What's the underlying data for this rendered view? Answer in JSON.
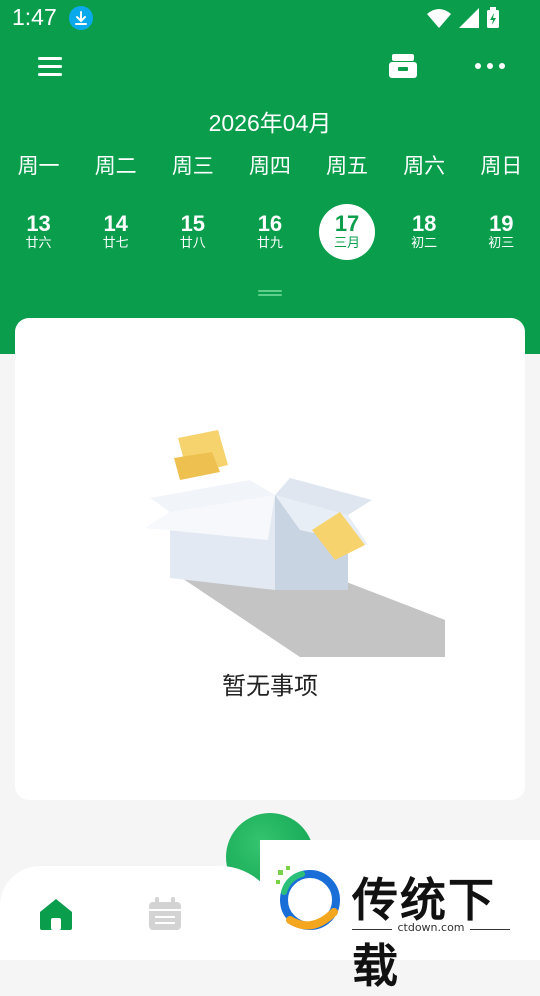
{
  "status_bar": {
    "time": "1:47"
  },
  "calendar": {
    "month_title": "2026年04月",
    "weekdays": [
      "周一",
      "周二",
      "周三",
      "周四",
      "周五",
      "周六",
      "周日"
    ],
    "days": [
      {
        "num": "13",
        "lunar": "廿六"
      },
      {
        "num": "14",
        "lunar": "廿七"
      },
      {
        "num": "15",
        "lunar": "廿八"
      },
      {
        "num": "16",
        "lunar": "廿九"
      },
      {
        "num": "17",
        "lunar": "三月"
      },
      {
        "num": "18",
        "lunar": "初二"
      },
      {
        "num": "19",
        "lunar": "初三"
      }
    ],
    "selected_day": "17"
  },
  "empty_state": {
    "message": "暂无事项"
  },
  "watermark": {
    "brand": "传统下载",
    "url": "ctdown.com"
  },
  "colors": {
    "brand_green": "#0a9e4c",
    "background": "#f5f5f5"
  }
}
